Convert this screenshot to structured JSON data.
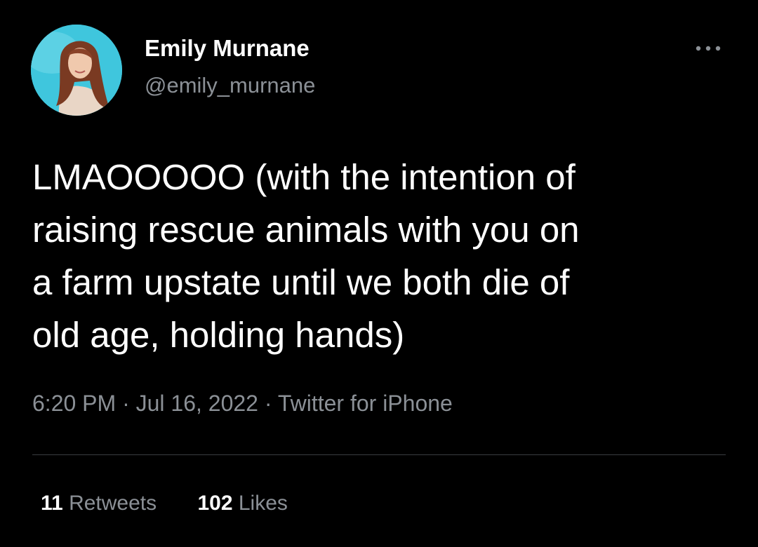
{
  "author": {
    "display_name": "Emily Murnane",
    "handle": "@emily_murnane"
  },
  "more_icon": "more-horizontal-icon",
  "tweet": {
    "text": "LMAOOOOO (with the intention of\nraising rescue animals with you on\na farm upstate until we both die of\nold age, holding hands)",
    "time": "6:20 PM",
    "date": "Jul 16, 2022",
    "source": "Twitter for iPhone",
    "separator": "·"
  },
  "stats": {
    "retweets_count": "11",
    "retweets_label": "Retweets",
    "likes_count": "102",
    "likes_label": "Likes"
  },
  "colors": {
    "background": "#000000",
    "primary_text": "#ffffff",
    "secondary_text": "#8b9096",
    "divider": "#3a3d41"
  }
}
